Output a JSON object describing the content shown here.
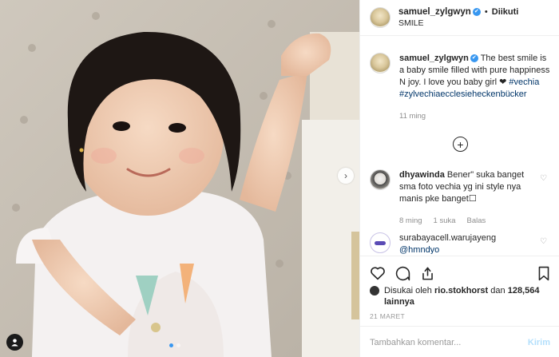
{
  "header": {
    "username": "samuel_zylgwyn",
    "verified_badge": "✔",
    "separator": "•",
    "follow_status": "Diikuti",
    "subtitle": "SMILE"
  },
  "caption": {
    "username": "samuel_zylgwyn",
    "text": "The best smile is a baby smile filled with pure happiness N joy. I love you baby girl ❤",
    "hashtag1": "#vechia",
    "hashtag2": "#zylvechiaecclesieheckenbücker",
    "time": "11 ming"
  },
  "load_more_icon": "plus-circle-icon",
  "comments": [
    {
      "username": "dhyawinda",
      "text": "Bener\" suka banget sma foto vechia yg ini style nya manis pke banget☐",
      "time": "8 ming",
      "likes": "1 suka",
      "reply": "Balas"
    },
    {
      "username": "surabayacell.warujayeng",
      "text": "@hmndyo"
    }
  ],
  "likes": {
    "prefix": "Disukai oleh",
    "user": "rio.stokhorst",
    "middle": "dan",
    "count": "128,564 lainnya"
  },
  "date": "21 MARET",
  "add_comment": {
    "placeholder": "Tambahkan komentar...",
    "post_label": "Kirim"
  },
  "colors": {
    "accent": "#3897f0",
    "link": "#003569",
    "post_disabled": "#b2dffc",
    "muted": "#8e8e8e"
  },
  "icons": [
    "heart-icon",
    "comment-icon",
    "share-icon",
    "bookmark-icon",
    "chevron-right-icon",
    "user-tag-icon"
  ],
  "carousel": {
    "current": 1,
    "total": 2
  }
}
